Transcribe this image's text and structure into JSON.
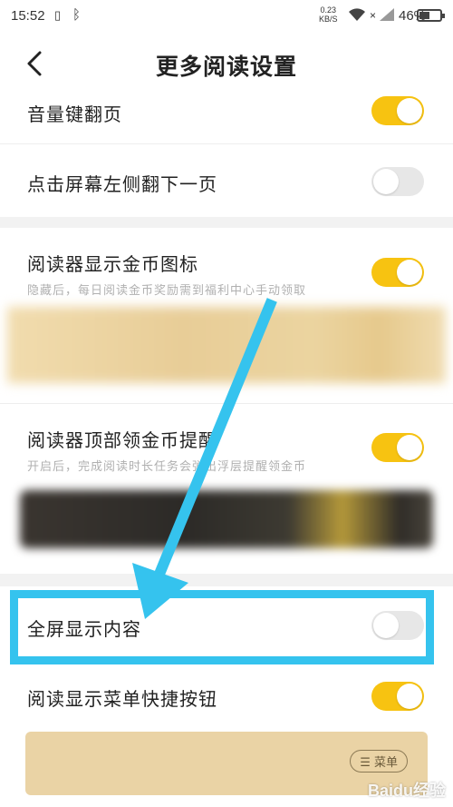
{
  "status_bar": {
    "time": "15:52",
    "net_speed_top": "0.23",
    "net_speed_bottom": "KB/S",
    "battery": "46%"
  },
  "header": {
    "title": "更多阅读设置"
  },
  "settings": [
    {
      "label": "音量键翻页",
      "on": true
    },
    {
      "label": "点击屏幕左侧翻下一页",
      "on": false
    },
    {
      "label": "阅读器显示金币图标",
      "sub": "隐藏后，每日阅读金币奖励需到福利中心手动领取",
      "on": true
    },
    {
      "label": "阅读器顶部领金币提醒",
      "sub": "开启后，完成阅读时长任务会弹出浮层提醒领金币",
      "on": true
    },
    {
      "label": "全屏显示内容",
      "on": false
    },
    {
      "label": "阅读显示菜单快捷按钮",
      "on": true
    }
  ],
  "menu_preview": {
    "chip_label": "☰ 菜单"
  },
  "watermark": "Baidu经验",
  "colors": {
    "toggle_on": "#f7c311",
    "toggle_off": "#e7e7e7",
    "annotation": "#35c3ee"
  }
}
